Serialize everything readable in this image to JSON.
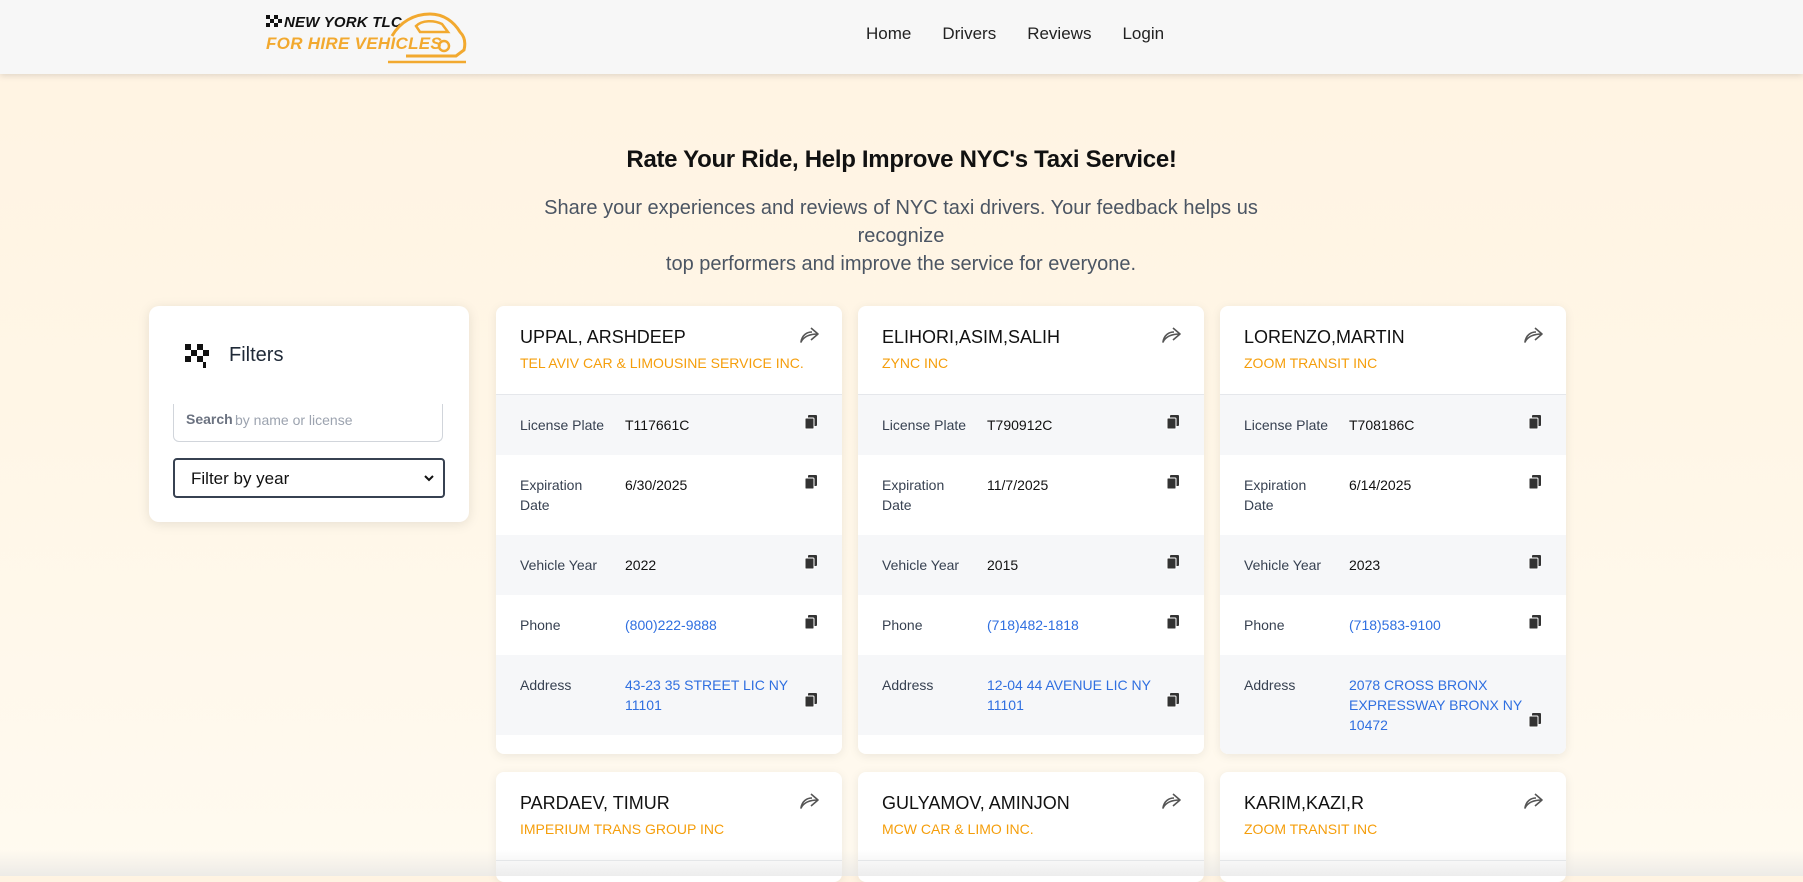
{
  "header": {
    "logo_line1": "NEW YORK TLC",
    "logo_line2": "FOR HIRE VEHICLES",
    "nav": [
      "Home",
      "Drivers",
      "Reviews",
      "Login"
    ]
  },
  "hero": {
    "title": "Rate Your Ride, Help Improve NYC's Taxi Service!",
    "subtitle_line1": "Share your experiences and reviews of NYC taxi drivers. Your feedback helps us recognize",
    "subtitle_line2": "top performers and improve the service for everyone."
  },
  "filters": {
    "title": "Filters",
    "search_label": "Search",
    "search_placeholder": "by name or license",
    "year_select": "Filter by year",
    "icon": "checkered-flag-icon"
  },
  "field_labels": {
    "plate": "License Plate",
    "expiration_line1": "Expiration",
    "expiration_line2": "Date",
    "year": "Vehicle Year",
    "phone": "Phone",
    "address": "Address"
  },
  "drivers": [
    {
      "name": "UPPAL, ARSHDEEP",
      "company": "TEL AVIV CAR & LIMOUSINE SERVICE INC.",
      "plate": "T117661C",
      "expiration": "6/30/2025",
      "year": "2022",
      "phone": "(800)222-9888",
      "address_lines": [
        "43-23 35 STREET LIC NY",
        "11101"
      ]
    },
    {
      "name": "ELIHORI,ASIM,SALIH",
      "company": "ZYNC INC",
      "plate": "T790912C",
      "expiration": "11/7/2025",
      "year": "2015",
      "phone": "(718)482-1818",
      "address_lines": [
        "12-04 44 AVENUE LIC NY",
        "11101"
      ]
    },
    {
      "name": "LORENZO,MARTIN",
      "company": "ZOOM TRANSIT INC",
      "plate": "T708186C",
      "expiration": "6/14/2025",
      "year": "2023",
      "phone": "(718)583-9100",
      "address_lines": [
        "2078 CROSS BRONX",
        "EXPRESSWAY BRONX NY",
        "10472"
      ]
    },
    {
      "name": "PARDAEV, TIMUR",
      "company": "IMPERIUM TRANS GROUP INC"
    },
    {
      "name": "GULYAMOV, AMINJON",
      "company": "MCW CAR & LIMO INC."
    },
    {
      "name": "KARIM,KAZI,R",
      "company": "ZOOM TRANSIT INC"
    }
  ],
  "colors": {
    "accent": "#f59e0b",
    "link": "#2f6fe0",
    "row_alt": "#f6f7f9"
  }
}
